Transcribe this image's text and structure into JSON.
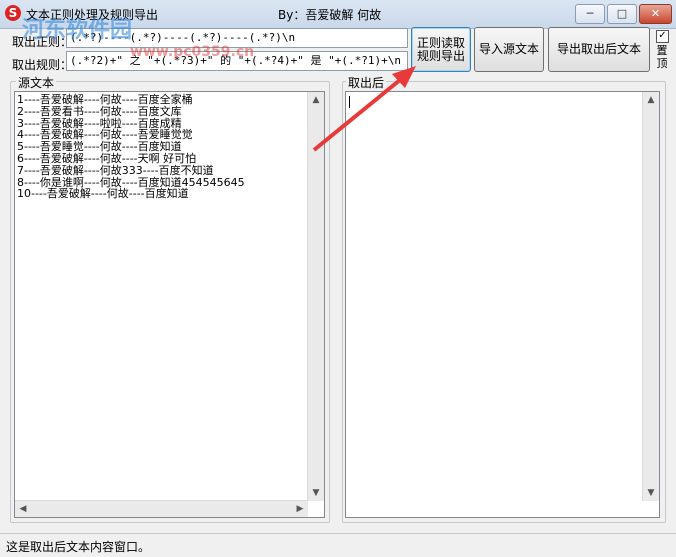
{
  "window": {
    "title": "文本正则处理及规则导出",
    "byline": "By：吾爱破解  何故",
    "minimize_glyph": "─",
    "maximize_glyph": "□",
    "close_glyph": "✕",
    "icon_letter": "S"
  },
  "toolbar": {
    "regex_label": "取出正则：",
    "regex_value": "(.*?)----(.*?)----(.*?)----(.*?)\\n",
    "rule_label": "取出规则：",
    "rule_value": "(.*?2)+\" 之 \"+(.*?3)+\" 的 \"+(.*?4)+\" 是 \"+(.*?1)+\\n",
    "regex_read_export_label": "正则读取\n规则导出",
    "import_source_label": "导入源文本",
    "export_result_label": "导出取出后文本",
    "pin_checkbox_checked": true,
    "pin_label": "置顶"
  },
  "source_panel": {
    "title": "源文本",
    "lines": [
      "1----吾爱破解----何故----百度全家桶",
      "2----吾爱看书----何故----百度文库",
      "3----吾爱破解----啦啦----百度成精",
      "4----吾爱破解----何故----吾爱睡觉觉",
      "5----吾爱睡觉----何故----百度知道",
      "6----吾爱破解----何故----天啊 好可怕",
      "7----吾爱破解----何故333----百度不知道",
      "8----你是谁啊----何故----百度知道454545645",
      "10----吾爱破解----何故----百度知道"
    ]
  },
  "result_panel": {
    "title": "取出后",
    "content": ""
  },
  "status": {
    "text": "这是取出后文本内容窗口。"
  },
  "watermark": {
    "text": "河东软件园",
    "url": "www.pc0359.cn"
  },
  "colors": {
    "arrow": "#e83a3a"
  }
}
